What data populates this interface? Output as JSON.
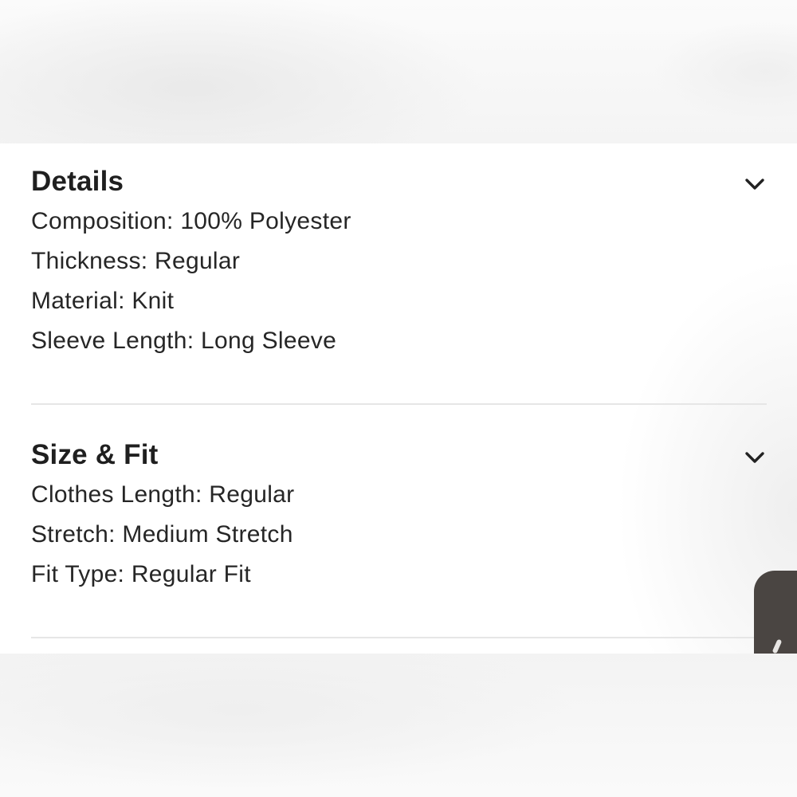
{
  "sections": {
    "details": {
      "title": "Details",
      "toggle_icon": "chevron-down-icon",
      "attributes": [
        {
          "text": "Composition: 100% Polyester"
        },
        {
          "text": "Thickness: Regular"
        },
        {
          "text": "Material: Knit"
        },
        {
          "text": "Sleeve Length: Long Sleeve"
        }
      ]
    },
    "size_fit": {
      "title": "Size & Fit",
      "toggle_icon": "chevron-down-icon",
      "attributes": [
        {
          "text": "Clothes Length: Regular"
        },
        {
          "text": "Stretch: Medium Stretch"
        },
        {
          "text": "Fit Type: Regular Fit"
        }
      ]
    }
  },
  "colors": {
    "title_text": "#1f1f1f",
    "body_text": "#262626",
    "divider": "#e6e6e6",
    "panel_background": "#ffffff"
  }
}
